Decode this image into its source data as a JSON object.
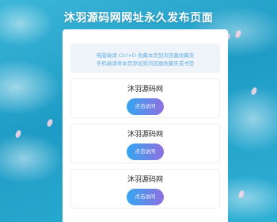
{
  "header": {
    "title": "沐羽源码网网址永久发布页面"
  },
  "notice": {
    "line1": "电脑端请 Ctrl+D 收藏本页到浏览器收藏夹",
    "line2": "手机端请将本页添加到浏览器收藏夹或书签"
  },
  "sites": [
    {
      "name": "沐羽源码网",
      "button_label": "点击访问"
    },
    {
      "name": "沐羽源码网",
      "button_label": "点击访问"
    },
    {
      "name": "沐羽源码网",
      "button_label": "点击访问"
    }
  ],
  "colors": {
    "background": "#27a9cf",
    "notice_text": "#6ab0e4",
    "button_gradient_start": "#33a6f0",
    "button_gradient_end": "#8f6fe0"
  }
}
